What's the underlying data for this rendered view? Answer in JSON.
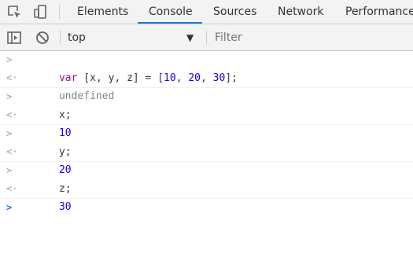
{
  "tabs": [
    {
      "label": "Elements",
      "active": false
    },
    {
      "label": "Console",
      "active": true
    },
    {
      "label": "Sources",
      "active": false
    },
    {
      "label": "Network",
      "active": false
    },
    {
      "label": "Performance",
      "active": false
    }
  ],
  "toolbar": {
    "context": "top",
    "filter_placeholder": "Filter"
  },
  "console": {
    "entries": [
      {
        "input_keyword": "var",
        "input_open": "[x, y, z] = [",
        "n1": "10",
        "sep1": ", ",
        "n2": "20",
        "sep2": ", ",
        "n3": "30",
        "input_close": "];",
        "output": "undefined"
      },
      {
        "input": "x;",
        "output": "10"
      },
      {
        "input": "y;",
        "output": "20"
      },
      {
        "input": "z;",
        "output": "30"
      }
    ]
  },
  "colors": {
    "accent": "#1a73e8",
    "keyword": "#aa0d91",
    "number": "#1c00cf",
    "undefined": "#80868b"
  },
  "icons": {
    "inspect": "inspect-element-icon",
    "device": "device-toolbar-icon",
    "sidebar": "show-sidebar-icon",
    "clear": "clear-console-icon",
    "dropdown": "chevron-down-icon",
    "input_prompt": "chevron-right-icon",
    "result_prompt": "result-arrow-icon"
  }
}
